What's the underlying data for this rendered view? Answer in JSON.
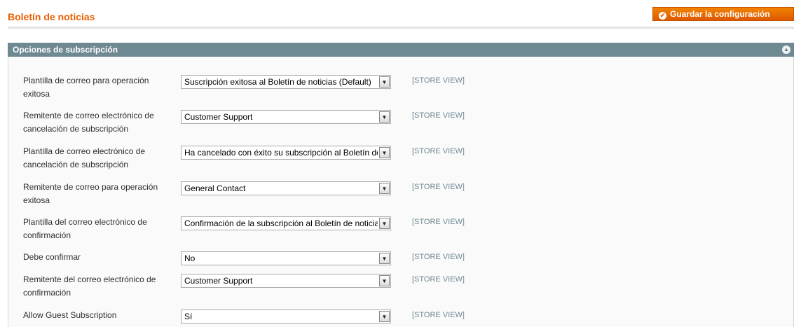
{
  "header": {
    "title": "Boletín de noticias",
    "save_label": "Guardar la configuración"
  },
  "section": {
    "title": "Opciones de subscripción"
  },
  "rows": [
    {
      "label": "Plantilla de correo para operación exitosa",
      "value": "Suscripción exitosa al Boletín de noticias (Default)",
      "scope": "[STORE VIEW]"
    },
    {
      "label": "Remitente de correo electrónico de cancelación de subscripción",
      "value": "Customer Support",
      "scope": "[STORE VIEW]"
    },
    {
      "label": "Plantilla de correo electrónico de cancelación de subscripción",
      "value": "Ha cancelado con éxito su subscripción al Boletín de noticias",
      "scope": "[STORE VIEW]"
    },
    {
      "label": "Remitente de correo para operación exitosa",
      "value": "General Contact",
      "scope": "[STORE VIEW]"
    },
    {
      "label": "Plantilla del correo electrónico de confirmación",
      "value": "Confirmación de la subscripción al Boletín de noticias",
      "scope": "[STORE VIEW]"
    },
    {
      "label": "Debe confirmar",
      "value": "No",
      "scope": "[STORE VIEW]"
    },
    {
      "label": "Remitente del correo electrónico de confirmación",
      "value": "Customer Support",
      "scope": "[STORE VIEW]"
    },
    {
      "label": "Allow Guest Subscription",
      "value": "Sí",
      "scope": "[STORE VIEW]"
    }
  ],
  "colors": {
    "accent": "#eb5e00",
    "section_header": "#6f8992"
  },
  "icons": {
    "save": "check-circle-icon",
    "collapse": "chevron-up-circle-icon",
    "select_arrow": "caret-down-icon"
  }
}
